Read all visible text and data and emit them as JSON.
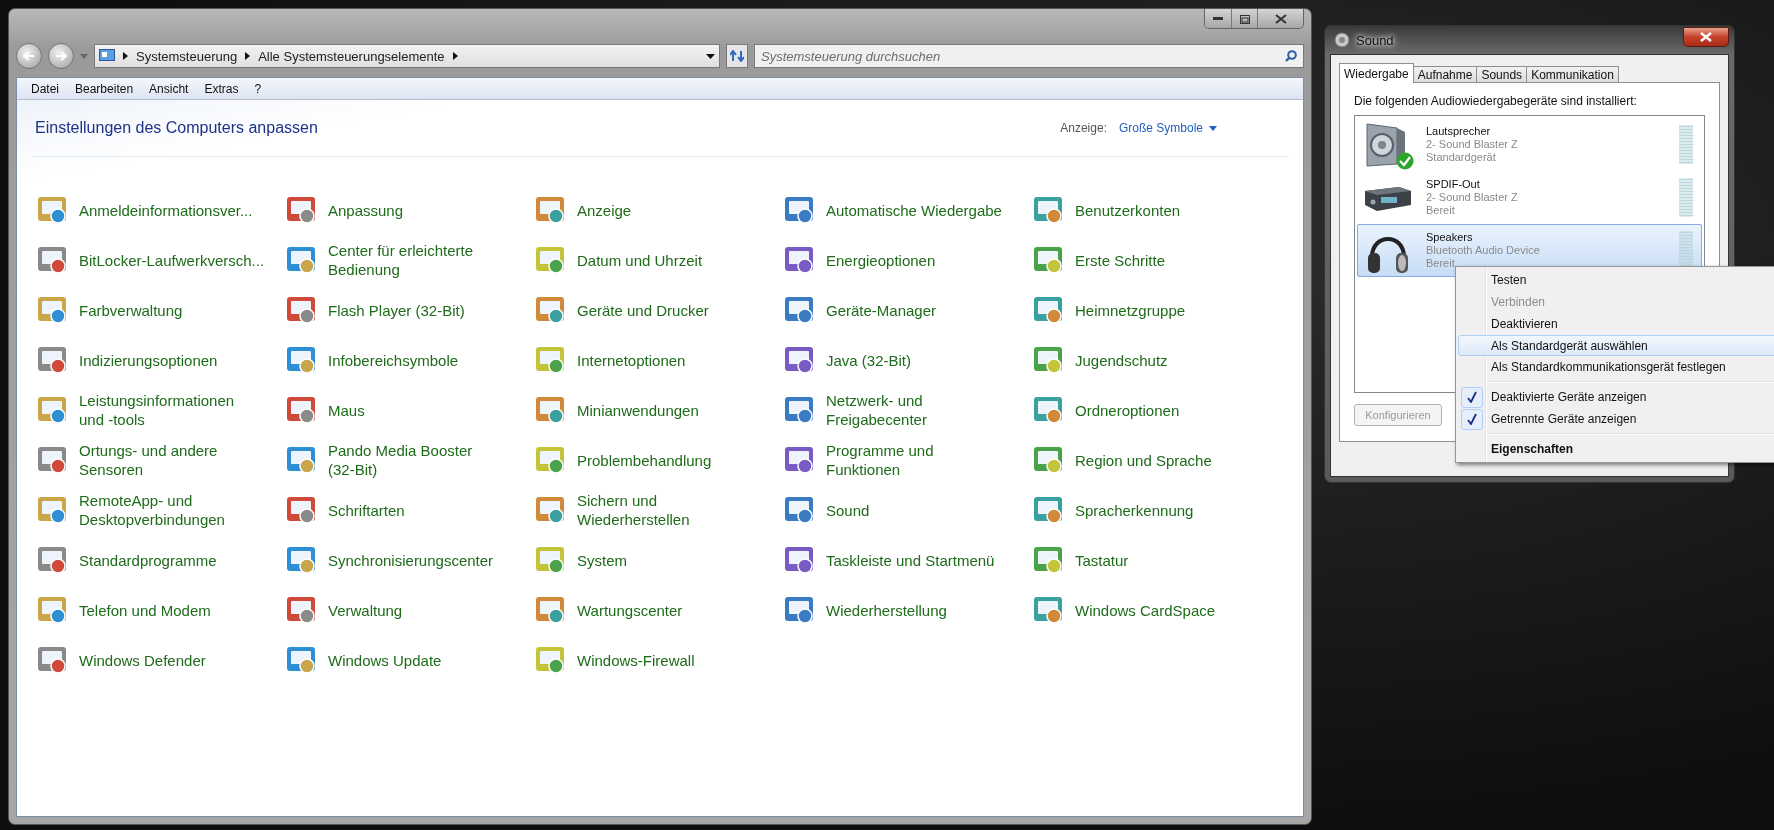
{
  "explorer": {
    "breadcrumbs": [
      "Systemsteuerung",
      "Alle Systemsteuerungselemente"
    ],
    "search": {
      "placeholder": "Systemsteuerung durchsuchen"
    },
    "menu": [
      "Datei",
      "Bearbeiten",
      "Ansicht",
      "Extras",
      "?"
    ],
    "heading": "Einstellungen des Computers anpassen",
    "view": {
      "label": "Anzeige:",
      "value": "Große Symbole"
    },
    "items": [
      {
        "label": "Anmeldeinformationsver..."
      },
      {
        "label": "Anpassung"
      },
      {
        "label": "Anzeige"
      },
      {
        "label": "Automatische Wiedergabe"
      },
      {
        "label": "Benutzerkonten"
      },
      {
        "label": "BitLocker-Laufwerkversch..."
      },
      {
        "label": "Center für erleichterte\nBedienung"
      },
      {
        "label": "Datum und Uhrzeit"
      },
      {
        "label": "Energieoptionen"
      },
      {
        "label": "Erste Schritte"
      },
      {
        "label": "Farbverwaltung"
      },
      {
        "label": "Flash Player (32-Bit)"
      },
      {
        "label": "Geräte und Drucker"
      },
      {
        "label": "Geräte-Manager"
      },
      {
        "label": "Heimnetzgruppe"
      },
      {
        "label": "Indizierungsoptionen"
      },
      {
        "label": "Infobereichsymbole"
      },
      {
        "label": "Internetoptionen"
      },
      {
        "label": "Java (32-Bit)"
      },
      {
        "label": "Jugendschutz"
      },
      {
        "label": "Leistungsinformationen\nund -tools"
      },
      {
        "label": "Maus"
      },
      {
        "label": "Minianwendungen"
      },
      {
        "label": "Netzwerk- und\nFreigabecenter"
      },
      {
        "label": "Ordneroptionen"
      },
      {
        "label": "Ortungs- und andere\nSensoren"
      },
      {
        "label": "Pando Media Booster\n(32-Bit)"
      },
      {
        "label": "Problembehandlung"
      },
      {
        "label": "Programme und\nFunktionen"
      },
      {
        "label": "Region und Sprache"
      },
      {
        "label": "RemoteApp- und\nDesktopverbindungen"
      },
      {
        "label": "Schriftarten"
      },
      {
        "label": "Sichern und\nWiederherstellen"
      },
      {
        "label": "Sound"
      },
      {
        "label": "Spracherkennung"
      },
      {
        "label": "Standardprogramme"
      },
      {
        "label": "Synchronisierungscenter"
      },
      {
        "label": "System"
      },
      {
        "label": "Taskleiste und Startmenü"
      },
      {
        "label": "Tastatur"
      },
      {
        "label": "Telefon und Modem"
      },
      {
        "label": "Verwaltung"
      },
      {
        "label": "Wartungscenter"
      },
      {
        "label": "Wiederherstellung"
      },
      {
        "label": "Windows CardSpace"
      },
      {
        "label": "Windows Defender"
      },
      {
        "label": "Windows Update"
      },
      {
        "label": "Windows-Firewall"
      }
    ]
  },
  "sound_dialog": {
    "title": "Sound",
    "tabs": [
      {
        "label": "Wiedergabe",
        "selected": true
      },
      {
        "label": "Aufnahme",
        "selected": false
      },
      {
        "label": "Sounds",
        "selected": false
      },
      {
        "label": "Kommunikation",
        "selected": false
      }
    ],
    "intro": "Die folgenden Audiowiedergabegeräte sind installiert:",
    "devices": [
      {
        "kind": "speaker",
        "name": "Lautsprecher",
        "detail": "2- Sound Blaster Z",
        "status": "Standardgerät",
        "default": true,
        "selected": false
      },
      {
        "kind": "receiver",
        "name": "SPDIF-Out",
        "detail": "2- Sound Blaster Z",
        "status": "Bereit",
        "default": false,
        "selected": false
      },
      {
        "kind": "headphones",
        "name": "Speakers",
        "detail": "Bluetooth Audio Device",
        "status": "Bereit",
        "default": false,
        "selected": true
      }
    ],
    "configure_button": {
      "label": "Konfigurieren",
      "disabled": true
    }
  },
  "context_menu": [
    {
      "kind": "item",
      "label": "Testen",
      "disabled": false,
      "selected": false
    },
    {
      "kind": "item",
      "label": "Verbinden",
      "disabled": true,
      "selected": false
    },
    {
      "kind": "item",
      "label": "Deaktivieren",
      "disabled": false,
      "selected": false
    },
    {
      "kind": "item",
      "label": "Als Standardgerät auswählen",
      "disabled": false,
      "selected": true
    },
    {
      "kind": "item",
      "label": "Als Standardkommunikationsgerät festlegen",
      "disabled": false,
      "selected": false
    },
    {
      "kind": "separator"
    },
    {
      "kind": "check",
      "label": "Deaktivierte Geräte anzeigen",
      "checked": true
    },
    {
      "kind": "check",
      "label": "Getrennte Geräte anzeigen",
      "checked": true
    },
    {
      "kind": "separator"
    },
    {
      "kind": "item",
      "label": "Eigenschaften",
      "disabled": false,
      "selected": false,
      "default": true
    }
  ]
}
